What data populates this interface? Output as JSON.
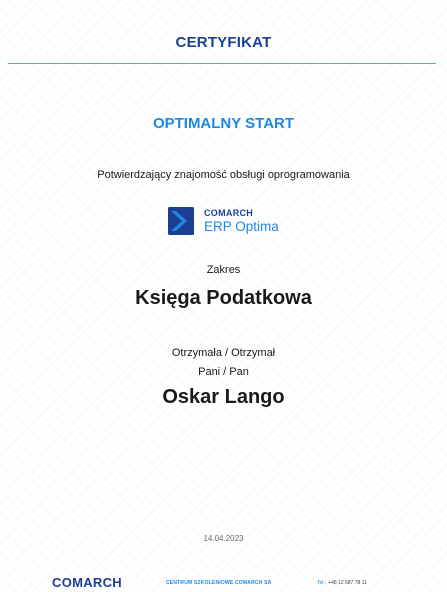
{
  "certificate": {
    "title": "CERTYFIKAT",
    "course_name": "OPTIMALNY START",
    "confirmation_text": "Potwierdzający znajomość obsługi oprogramowania",
    "product_logo": {
      "brand": "COMARCH",
      "product": "ERP Optima",
      "icon": "comarch-chevron-icon"
    },
    "scope_label": "Zakres",
    "scope_value": "Księga Podatkowa",
    "received_label": "Otrzymała / Otrzymał",
    "honorific": "Pani / Pan",
    "recipient_name": "Oskar Lango",
    "issue_date": "14.04.2023"
  },
  "footer": {
    "logo_text": "COMARCH",
    "training_center": "CENTRUM SZKOLENIOWE COMARCH SA",
    "phone_label": "Tel.:",
    "phone_number": "+48 12 687 78 11"
  },
  "colors": {
    "navy": "#1c3f94",
    "blue": "#1e88e5",
    "rule": "#58a6e6",
    "text": "#1a1a1a",
    "muted": "#6b6b6b"
  }
}
